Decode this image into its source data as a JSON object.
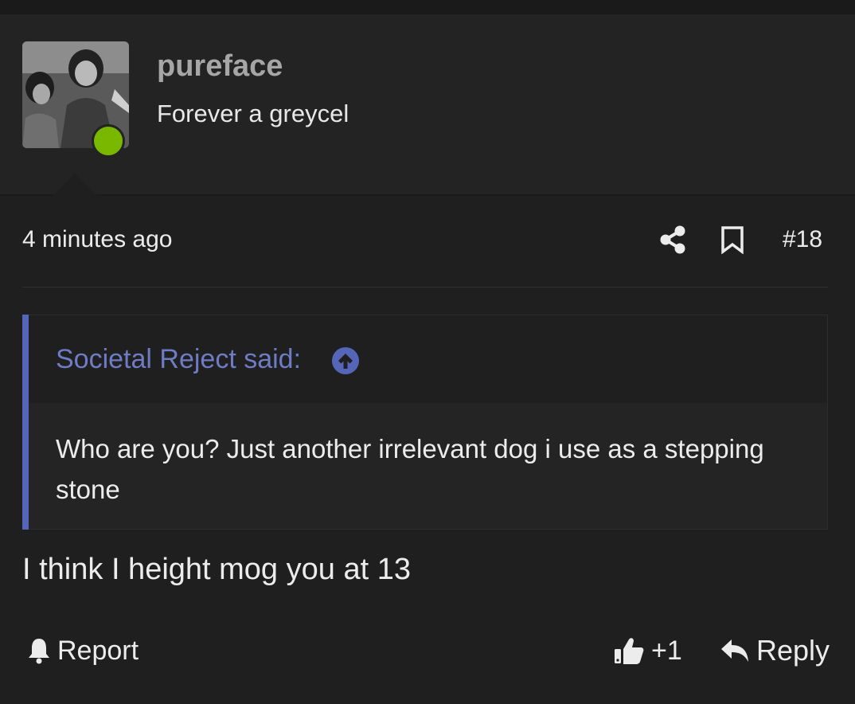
{
  "post": {
    "author": "pureface",
    "user_title": "Forever a greycel",
    "time": "4 minutes ago",
    "post_number": "#18",
    "quote": {
      "author_label": "Societal Reject said:",
      "text": "Who are you? Just another irrelevant dog i use as a stepping stone"
    },
    "message": "I think I height mog you at 13"
  },
  "actions": {
    "report_label": "Report",
    "reaction_count": "+1",
    "reply_label": "Reply"
  },
  "colors": {
    "background": "#1f1f1f",
    "online": "#7ab800",
    "quote_accent": "#5566b8",
    "quote_author": "#6d7cc4"
  },
  "icons": [
    "share-icon",
    "bookmark-icon",
    "arrow-up-circle-icon",
    "bell-icon",
    "thumbs-up-icon",
    "reply-arrow-icon"
  ]
}
